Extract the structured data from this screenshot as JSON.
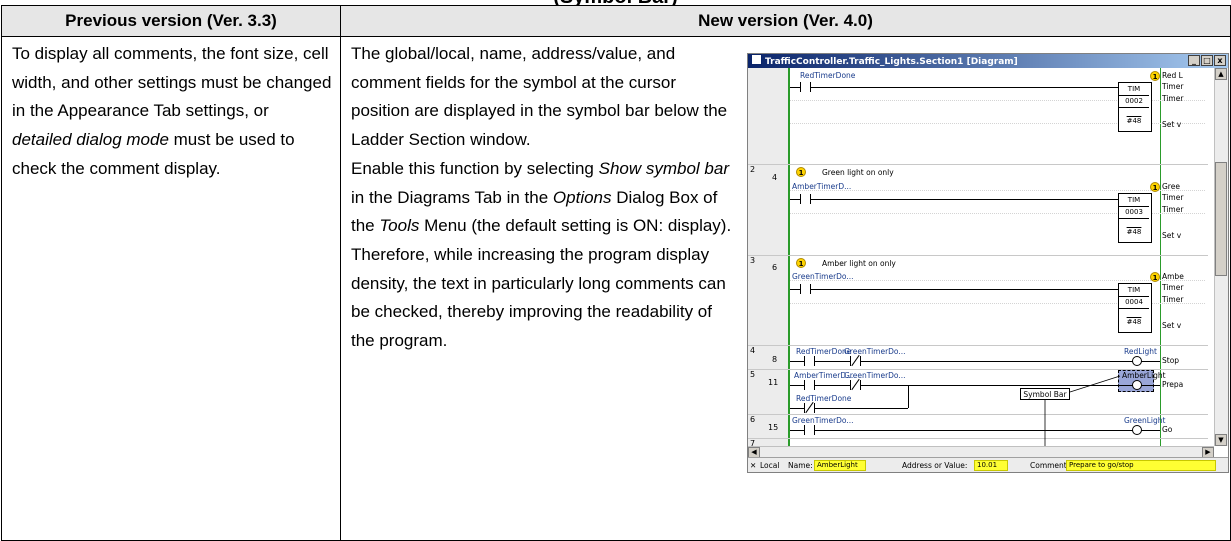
{
  "partial_title": "(Symbol Bar)",
  "headers": {
    "previous": "Previous version (Ver. 3.3)",
    "new": "New version (Ver. 4.0)"
  },
  "previous": {
    "text1": "To display all comments, the font size, cell width, and other settings must be changed in the Appearance Tab settings, or ",
    "italic": "detailed dialog mode",
    "text2": " must be used to check the comment display."
  },
  "new": {
    "p1": "The global/local, name, address/value, and comment fields for the symbol at the cursor position are displayed in the symbol bar below the Ladder Section window.",
    "p2a": "Enable this function by selecting ",
    "p2_italic1": "Show symbol bar",
    "p2b": " in the Diagrams Tab in the ",
    "p2_italic2": "Options",
    "p2c": " Dialog Box of the ",
    "p2_italic3": "Tools",
    "p2d": " Menu (the default setting is ON: display).",
    "p3": "Therefore, while increasing the program display density, the text in particularly long comments can be checked, thereby improving the readability of the program."
  },
  "screenshot": {
    "title": "TrafficController.Traffic_Lights.Section1 [Diagram]",
    "window_buttons": [
      "_",
      "□",
      "x"
    ],
    "row_numbers": [
      "2",
      "3",
      "4",
      "5",
      "6",
      "7"
    ],
    "step_numbers": [
      "4",
      "6",
      "8",
      "11",
      "15"
    ],
    "comments": [
      "Green light on only",
      "Amber light on only"
    ],
    "contacts": [
      "RedTimerDone",
      "AmberTimerD...",
      "GreenTimerDo...",
      "RedTimerDone",
      "GreenTimerDo...",
      "AmberTimerD...",
      "GreenTimerDo...",
      "RedTimerDone",
      "GreenTimerDo..."
    ],
    "coils": [
      "RedLight",
      "AmberLight",
      "GreenLight"
    ],
    "timers": [
      {
        "name": "TIM",
        "num": "0002",
        "set": "#48"
      },
      {
        "name": "TIM",
        "num": "0003",
        "set": "#48"
      },
      {
        "name": "TIM",
        "num": "0004",
        "set": "#48"
      }
    ],
    "right_texts": [
      "Red L",
      "Timer",
      "Timer",
      "Set v",
      "Gree",
      "Timer",
      "Timer",
      "Set v",
      "Ambe",
      "Timer",
      "Timer",
      "Set v",
      "Stop",
      "Prepa",
      "Go"
    ],
    "badge": "1",
    "callout": "Symbol Bar",
    "status": {
      "scope": "Local",
      "name_label": "Name:",
      "name_value": "AmberLight",
      "address_label": "Address or Value:",
      "address_value": "10.01",
      "comment_label": "Comment:",
      "comment_value": "Prepare to go/stop"
    },
    "colors": {
      "rail": "#2a9b2a",
      "highlight": "#ffff33",
      "selection": "#9aa6d8",
      "titlebar": "#0a246a"
    }
  }
}
